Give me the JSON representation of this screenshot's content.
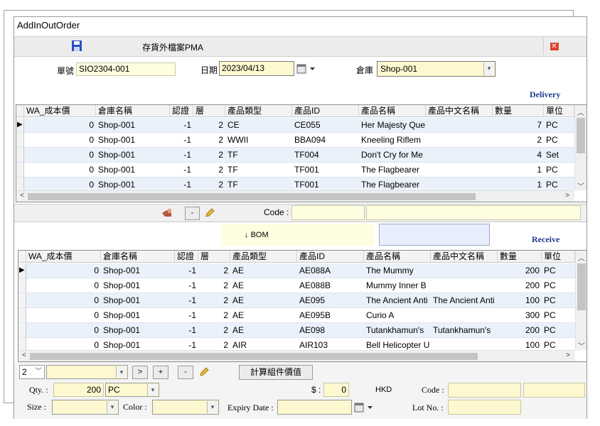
{
  "window": {
    "title": "AddInOutOrder"
  },
  "toolbar": {
    "save_icon": "floppy-disk-icon",
    "pma_label": "存貨外檔案PMA",
    "close_icon": "close-icon"
  },
  "header": {
    "order_no_label": "單號",
    "order_no_value": "SIO2304-001",
    "date_label": "日期",
    "date_value": "2023/04/13",
    "warehouse_label": "倉庫",
    "warehouse_value": "Shop-001"
  },
  "delivery": {
    "section_title": "Delivery",
    "columns": [
      "WA_成本價",
      "倉庫名稱",
      "認證",
      "層",
      "產品類型",
      "產品ID",
      "產品名稱",
      "產品中文名稱",
      "數量",
      "單位"
    ],
    "rows": [
      [
        "0",
        "Shop-001",
        "-1",
        "2",
        "CE",
        "CE055",
        "Her Majesty Que",
        "",
        "7",
        "PC"
      ],
      [
        "0",
        "Shop-001",
        "-1",
        "2",
        "WWII",
        "BBA094",
        "Kneeling Riflem",
        "",
        "2",
        "PC"
      ],
      [
        "0",
        "Shop-001",
        "-1",
        "2",
        "TF",
        "TF004",
        "Don't Cry for Me",
        "",
        "4",
        "Set"
      ],
      [
        "0",
        "Shop-001",
        "-1",
        "2",
        "TF",
        "TF001",
        "The Flagbearer",
        "",
        "1",
        "PC"
      ],
      [
        "0",
        "Shop-001",
        "-1",
        "2",
        "TF",
        "TF001",
        "The Flagbearer",
        "",
        "1",
        "PC"
      ]
    ],
    "code_label": "Code :",
    "minus_label": "-"
  },
  "bom": {
    "label": "BOM"
  },
  "receive": {
    "section_title": "Receive",
    "columns": [
      "WA_成本價",
      "倉庫名稱",
      "認證",
      "層",
      "產品類型",
      "產品ID",
      "產品名稱",
      "產品中文名稱",
      "數量",
      "單位"
    ],
    "rows": [
      [
        "0",
        "Shop-001",
        "-1",
        "2",
        "AE",
        "AE088A",
        "The Mummy",
        "",
        "200",
        "PC"
      ],
      [
        "0",
        "Shop-001",
        "-1",
        "2",
        "AE",
        "AE088B",
        "Mummy Inner B",
        "",
        "200",
        "PC"
      ],
      [
        "0",
        "Shop-001",
        "-1",
        "2",
        "AE",
        "AE095",
        "The Ancient Anti",
        "The Ancient Anti",
        "100",
        "PC"
      ],
      [
        "0",
        "Shop-001",
        "-1",
        "2",
        "AE",
        "AE095B",
        "Curio A",
        "",
        "300",
        "PC"
      ],
      [
        "0",
        "Shop-001",
        "-1",
        "2",
        "AE",
        "AE098",
        "Tutankhamun's",
        "Tutankhamun's",
        "200",
        "PC"
      ],
      [
        "0",
        "Shop-001",
        "-1",
        "2",
        "AIR",
        "AIR103",
        "Bell Helicopter U",
        "",
        "100",
        "PC"
      ]
    ]
  },
  "bottom_controls": {
    "level_value": "2",
    "next_label": ">",
    "plus_label": "+",
    "minus_label": "-",
    "calc_button": "計算組件價值"
  },
  "form": {
    "qty_label": "Qty. :",
    "qty_value": "200",
    "unit_value": "PC",
    "price_label": "$ :",
    "price_value": "0",
    "currency": "HKD",
    "code_label": "Code :",
    "size_label": "Size :",
    "color_label": "Color :",
    "expiry_label": "Expiry Date :",
    "lot_label": "Lot No. :"
  }
}
